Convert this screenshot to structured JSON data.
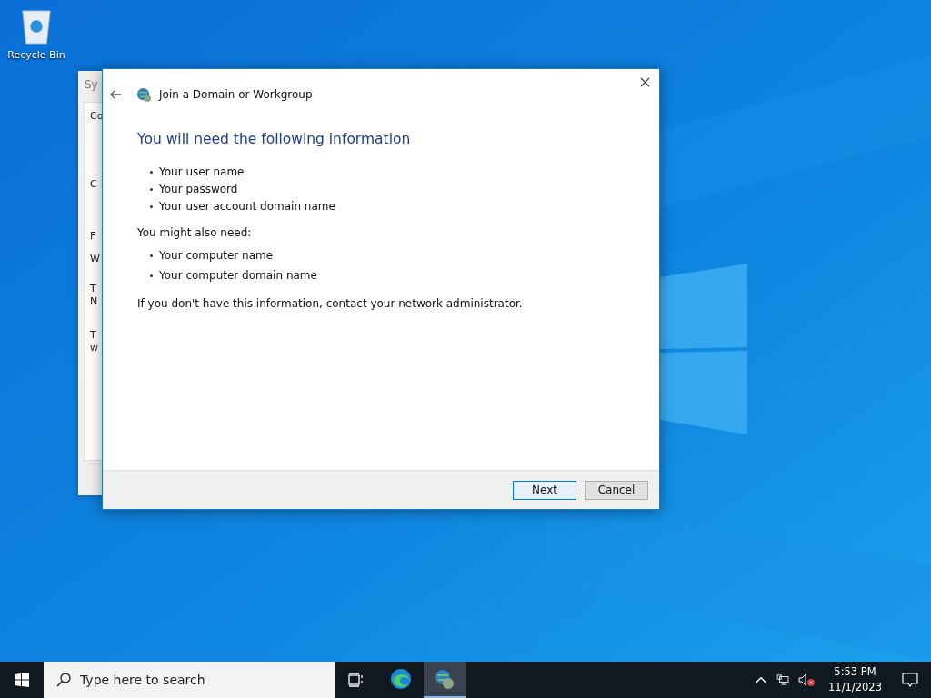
{
  "desktop": {
    "icons": [
      {
        "label": "Recycle Bin"
      }
    ]
  },
  "background_window": {
    "title": "Sy",
    "fragments": [
      "Co",
      "C",
      "F",
      "W",
      "T",
      "N",
      "T",
      "w"
    ]
  },
  "dialog": {
    "title": "Join a Domain or Workgroup",
    "heading": "You will need the following information",
    "required": [
      "Your user name",
      "Your password",
      "Your user account domain name"
    ],
    "also_label": "You might also need:",
    "optional": [
      "Your computer name",
      "Your computer domain name"
    ],
    "footer_text": "If you don't have this information, contact your network administrator.",
    "buttons": [
      {
        "label": "Next",
        "kind": "default"
      },
      {
        "label": "Cancel",
        "kind": "normal"
      }
    ]
  },
  "taskbar": {
    "search": {
      "placeholder": "Type here to search"
    },
    "apps": [
      {
        "kind": "edge",
        "selected": false
      },
      {
        "kind": "network",
        "selected": true
      }
    ],
    "clock": {
      "time": "5:53 PM",
      "date": "11/1/2023"
    }
  }
}
